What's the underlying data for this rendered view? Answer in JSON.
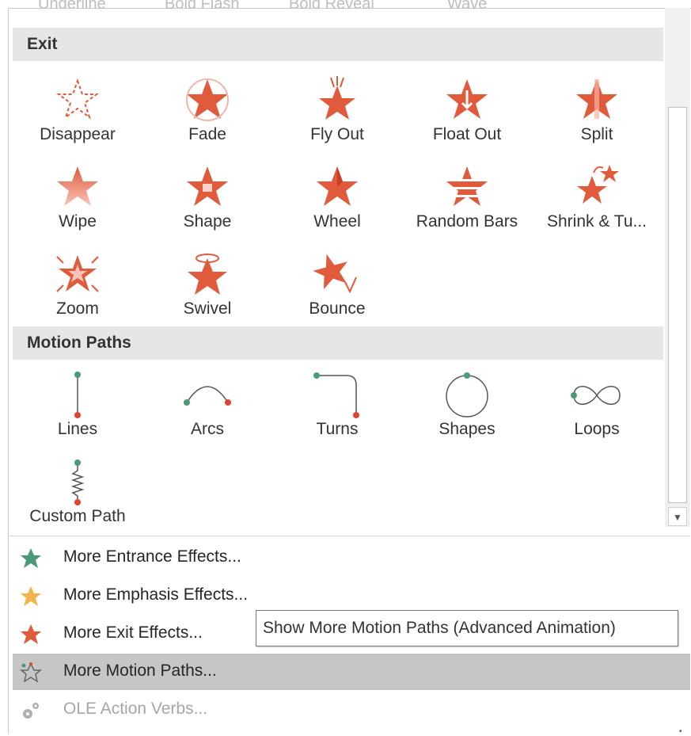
{
  "top_partial": [
    "Underline",
    "Bold Flash",
    "Bold Reveal",
    "Wave"
  ],
  "sections": {
    "exit": {
      "title": "Exit",
      "items": [
        "Disappear",
        "Fade",
        "Fly Out",
        "Float Out",
        "Split",
        "Wipe",
        "Shape",
        "Wheel",
        "Random Bars",
        "Shrink & Tu...",
        "Zoom",
        "Swivel",
        "Bounce"
      ]
    },
    "motion": {
      "title": "Motion Paths",
      "items": [
        "Lines",
        "Arcs",
        "Turns",
        "Shapes",
        "Loops",
        "Custom Path"
      ]
    }
  },
  "menu": {
    "entrance": "More Entrance Effects...",
    "emphasis": "More Emphasis Effects...",
    "exit": "More Exit Effects...",
    "motion": "More Motion Paths...",
    "ole": "OLE Action Verbs..."
  },
  "tooltip": "Show More Motion Paths (Advanced Animation)",
  "colors": {
    "exit_star": "#e05a3c",
    "entrance_star": "#4a9a78",
    "emphasis_star": "#f0b64d",
    "path_start": "#4a9a78",
    "path_end": "#e0452f",
    "hover": "#c6c6c6"
  },
  "icons": {
    "exit": "exit-star-icon",
    "entrance": "entrance-star-icon",
    "emphasis": "emphasis-star-icon",
    "motion": "motion-path-star-icon",
    "ole": "gears-icon",
    "scroll_down": "scroll-down-arrow-icon"
  }
}
